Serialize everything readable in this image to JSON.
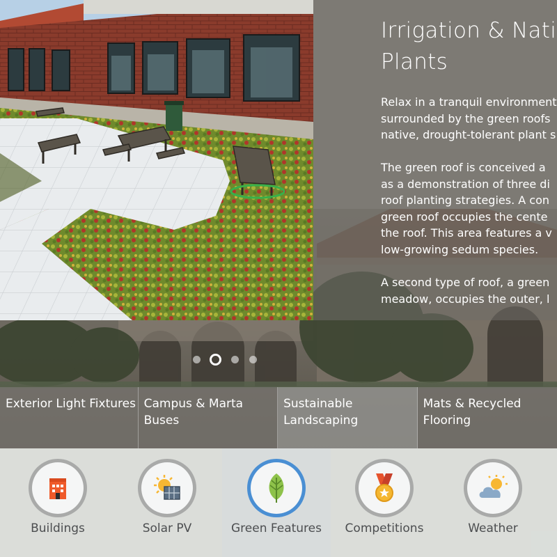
{
  "feature": {
    "title": "Irrigation & Native\nPlants",
    "paragraphs": [
      "Relax in a tranquil environment\nsurrounded by the green roofs\nnative, drought-tolerant plant s",
      "The green roof is conceived a\nas a demonstration of three di\nroof planting strategies. A con\ngreen roof occupies the cente\nthe roof. This area features a v\nlow-growing sedum species.",
      "A second type of roof, a green\nmeadow, occupies the outer, l"
    ]
  },
  "carousel": {
    "page_count": 4,
    "active_index": 1
  },
  "subtabs": [
    {
      "label": "Exterior Light Fixtures"
    },
    {
      "label": "Campus & Marta\nBuses"
    },
    {
      "label": "Sustainable\nLandscaping",
      "selected": true
    },
    {
      "label": "Mats & Recycled\nFlooring"
    }
  ],
  "categories": [
    {
      "label": "Buildings",
      "icon": "building-icon"
    },
    {
      "label": "Solar PV",
      "icon": "solar-panel-icon"
    },
    {
      "label": "Green Features",
      "icon": "leaf-icon",
      "selected": true
    },
    {
      "label": "Competitions",
      "icon": "medal-icon"
    },
    {
      "label": "Weather",
      "icon": "weather-icon"
    }
  ],
  "colors": {
    "selected_ring": "#4a8fd3",
    "leaf": "#8ec24a",
    "building": "#ef5a2a",
    "label_text": "#4c4e50"
  }
}
